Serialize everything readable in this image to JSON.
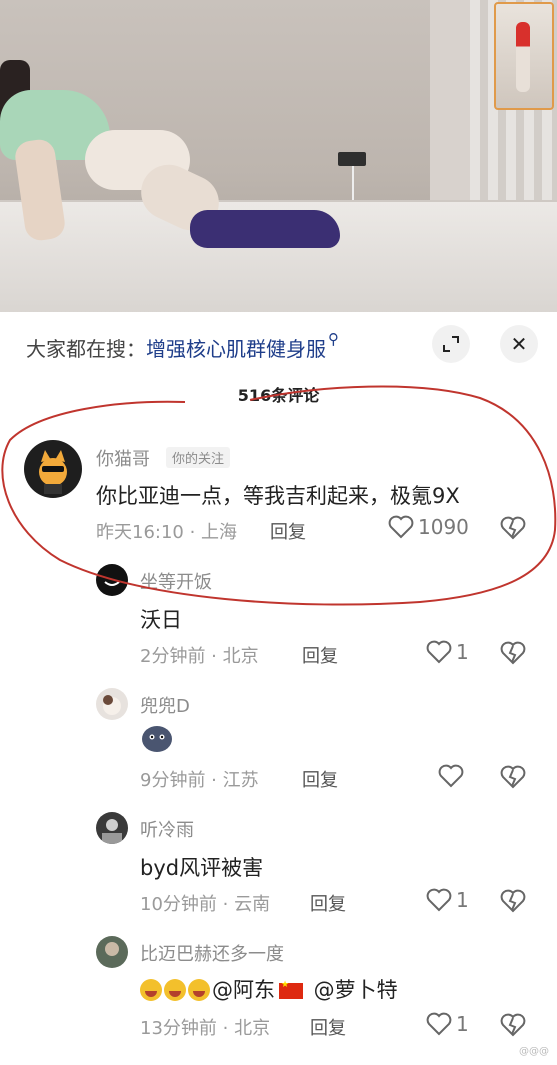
{
  "header": {
    "search_prefix": "大家都在搜：",
    "search_term": "增强核心肌群健身服",
    "expand_icon": "expand-icon",
    "close_label": "✕"
  },
  "comment_count": "516条评论",
  "comments": [
    {
      "user": "你猫哥",
      "tag": "你的关注",
      "text": "你比亚迪一点，等我吉利起来，极氪9X",
      "meta": "昨天16:10 · 上海",
      "reply": "回复",
      "likes": "1090"
    },
    {
      "user": "坐等开饭",
      "text": "沃日",
      "meta": "2分钟前 · 北京",
      "reply": "回复",
      "likes": "1"
    },
    {
      "user": "兜兜D",
      "text": "",
      "meta": "9分钟前 · 江苏",
      "reply": "回复",
      "likes": ""
    },
    {
      "user": "听冷雨",
      "text": "byd风评被害",
      "meta": "10分钟前 · 云南",
      "reply": "回复",
      "likes": "1"
    },
    {
      "user": "比迈巴赫还多一度",
      "text_part1": "@阿东",
      "text_part2": " @萝卜特",
      "meta": "13分钟前 · 北京",
      "reply": "回复",
      "likes": "1"
    }
  ],
  "colors": {
    "annotation": "#c0352e",
    "link": "#1f3e8a"
  },
  "watermark": "@@@"
}
